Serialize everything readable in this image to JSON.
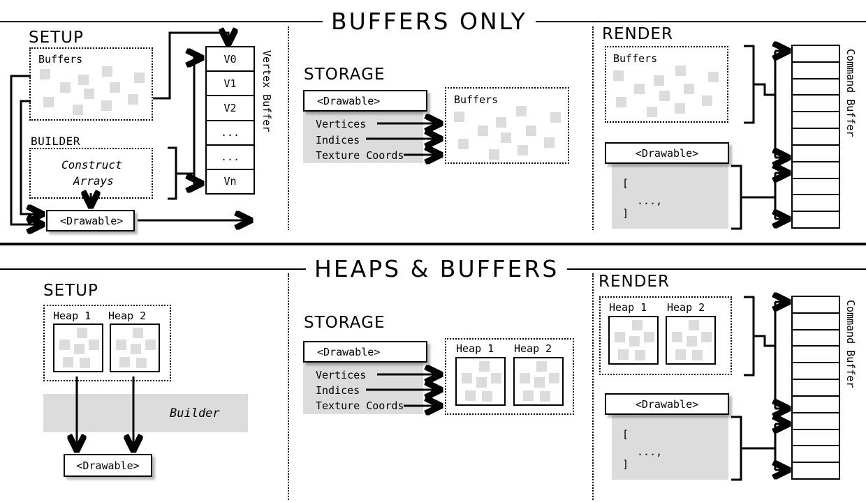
{
  "panels": [
    {
      "title": "BUFFERS ONLY",
      "setup": {
        "heading": "SETUP",
        "buffers_label": "Buffers",
        "builder_heading": "BUILDER",
        "construct_line1": "Construct",
        "construct_line2": "Arrays",
        "drawable_label": "<Drawable>"
      },
      "vertex_buffer": {
        "label": "Vertex Buffer",
        "rows": [
          "V0",
          "V1",
          "V2",
          "...",
          "...",
          "Vn"
        ]
      },
      "storage": {
        "heading": "STORAGE",
        "drawable_label": "<Drawable>",
        "fields": [
          "Vertices",
          "Indices",
          "Texture Coords"
        ],
        "target_label": "Buffers"
      },
      "render": {
        "heading": "RENDER",
        "buffers_label": "Buffers",
        "drawable_label": "<Drawable>",
        "code_line1": "[",
        "code_line2": "...,",
        "code_line3": "]",
        "command_buffer_label": "Command Buffer",
        "command_buffer_rows": 11
      }
    },
    {
      "title": "HEAPS & BUFFERS",
      "setup": {
        "heading": "SETUP",
        "heap1_label": "Heap 1",
        "heap2_label": "Heap 2",
        "builder_label": "Builder",
        "drawable_label": "<Drawable>"
      },
      "storage": {
        "heading": "STORAGE",
        "drawable_label": "<Drawable>",
        "fields": [
          "Vertices",
          "Indices",
          "Texture Coords"
        ],
        "heap1_label": "Heap 1",
        "heap2_label": "Heap 2"
      },
      "render": {
        "heading": "RENDER",
        "heap1_label": "Heap 1",
        "heap2_label": "Heap 2",
        "drawable_label": "<Drawable>",
        "code_line1": "[",
        "code_line2": "...,",
        "code_line3": "]",
        "command_buffer_label": "Command Buffer",
        "command_buffer_rows": 11
      }
    }
  ],
  "colors": {
    "ink": "#000000",
    "square_fill": "#dcdcdc",
    "grey_block": "#dcdcdc",
    "background": "#ffffff"
  }
}
